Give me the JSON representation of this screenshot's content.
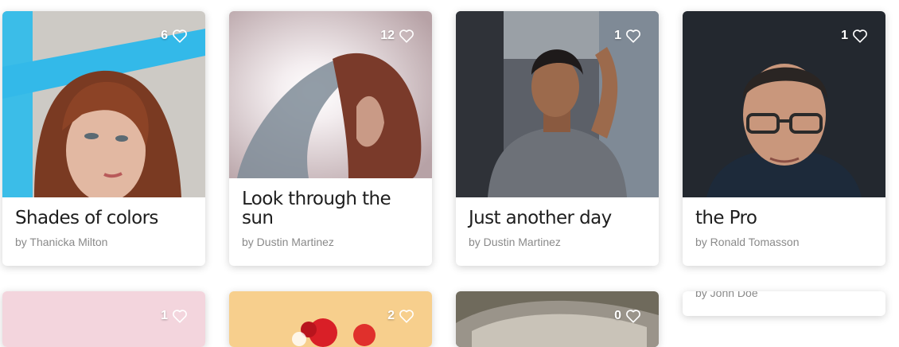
{
  "cards": [
    {
      "title": "Shades of colors",
      "author": "by Thanicka Milton",
      "likes": "6"
    },
    {
      "title": "Look through the sun",
      "author": "by Dustin Martinez",
      "likes": "12"
    },
    {
      "title": "Just another day",
      "author": "by Dustin Martinez",
      "likes": "1"
    },
    {
      "title": "the Pro",
      "author": "by Ronald Tomasson",
      "likes": "1"
    },
    {
      "likes": "1"
    },
    {
      "likes": "2"
    },
    {
      "likes": "0"
    },
    {
      "author": "by John Doe"
    }
  ],
  "colors": {
    "title": "#1e1e1e",
    "author": "#8a8a8a",
    "like": "#ffffff"
  }
}
